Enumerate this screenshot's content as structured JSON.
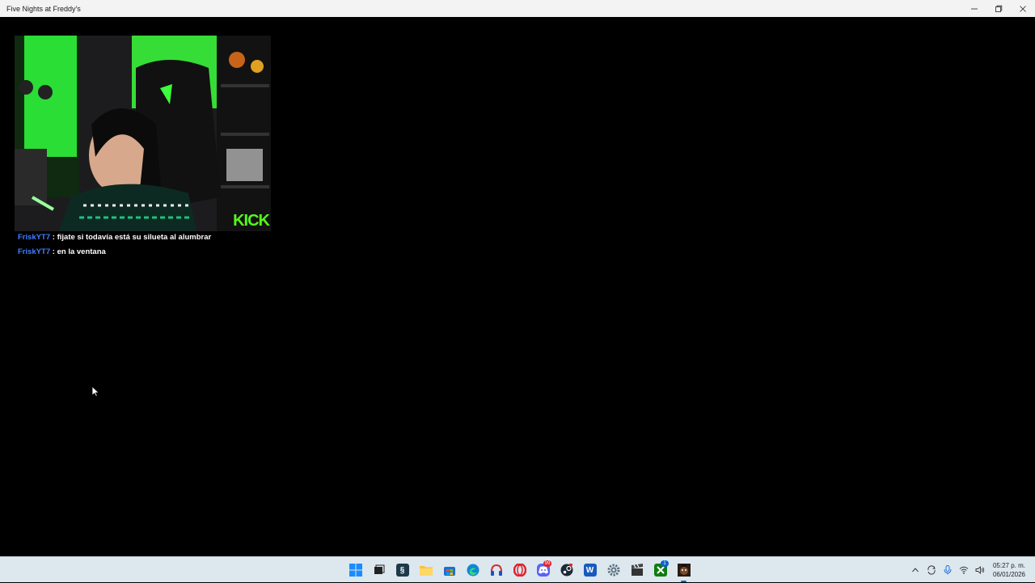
{
  "window": {
    "title": "Five Nights at Freddy's",
    "controls": [
      "minimize",
      "restore",
      "close"
    ]
  },
  "webcam": {
    "logo_text": "KICK",
    "accent_color": "#53fc18"
  },
  "chat": [
    {
      "user": "FriskYT7",
      "separator": " : ",
      "message": "fijate si todavía está su silueta al alumbrar"
    },
    {
      "user": "FriskYT7",
      "separator": " : ",
      "message": "en la ventana"
    }
  ],
  "taskbar": {
    "apps": [
      {
        "name": "start",
        "icon": "windows-start-icon"
      },
      {
        "name": "task-view",
        "icon": "task-view-icon"
      },
      {
        "name": "app-s",
        "icon": "s-app-icon"
      },
      {
        "name": "file-explorer",
        "icon": "folder-icon"
      },
      {
        "name": "store",
        "icon": "store-icon"
      },
      {
        "name": "edge",
        "icon": "edge-icon"
      },
      {
        "name": "headphones-app",
        "icon": "headphones-icon"
      },
      {
        "name": "opera",
        "icon": "opera-icon"
      },
      {
        "name": "discord",
        "icon": "discord-icon",
        "badge": "99"
      },
      {
        "name": "steam",
        "icon": "steam-icon"
      },
      {
        "name": "word",
        "icon": "word-icon"
      },
      {
        "name": "settings",
        "icon": "gear-icon"
      },
      {
        "name": "recorder",
        "icon": "clapper-icon"
      },
      {
        "name": "xbox",
        "icon": "xbox-icon",
        "badge": "1"
      },
      {
        "name": "fnaf",
        "icon": "fnaf-icon"
      }
    ],
    "tray": {
      "icons": [
        "chevron-up-icon",
        "sync-icon",
        "mic-icon",
        "wifi-icon",
        "speaker-icon"
      ],
      "time": "05:27 p. m.",
      "date": "06/01/2026"
    }
  }
}
